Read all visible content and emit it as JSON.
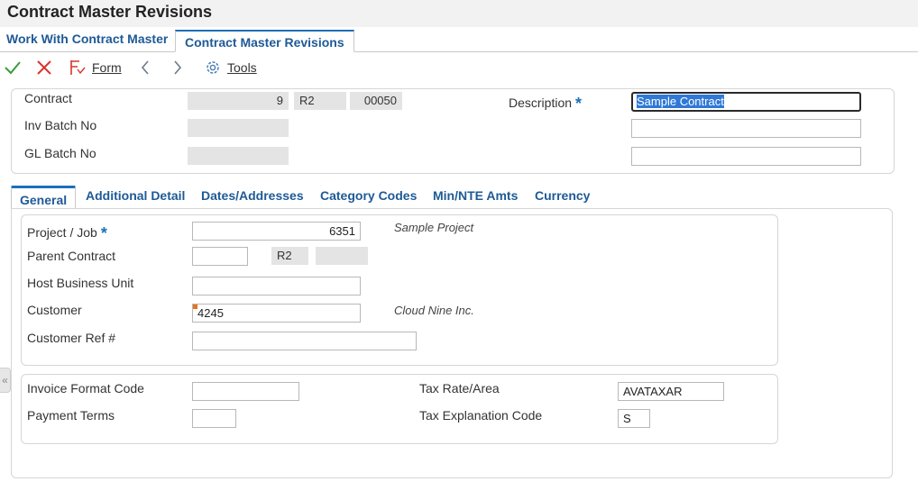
{
  "window": {
    "title": "Contract Master Revisions"
  },
  "breadcrumbs": [
    {
      "label": "Work With Contract Master"
    },
    {
      "label": "Contract Master Revisions"
    }
  ],
  "toolbar": {
    "ok_icon": "checkmark-icon",
    "cancel_icon": "x-icon",
    "form_label": "Form",
    "prev_icon": "chevron-left-icon",
    "next_icon": "chevron-right-icon",
    "tools_label": "Tools"
  },
  "header": {
    "contract_label": "Contract",
    "contract_number": "9",
    "contract_type": "R2",
    "contract_company": "00050",
    "description_label": "Description",
    "description_value": "Sample Contract",
    "inv_batch_label": "Inv Batch No",
    "inv_batch_value": "",
    "gl_batch_label": "GL Batch No",
    "gl_batch_value": "",
    "description_line2": "",
    "description_line3": ""
  },
  "tabs": [
    {
      "label": "General"
    },
    {
      "label": "Additional Detail"
    },
    {
      "label": "Dates/Addresses"
    },
    {
      "label": "Category Codes"
    },
    {
      "label": "Min/NTE Amts"
    },
    {
      "label": "Currency"
    }
  ],
  "general": {
    "project_label": "Project / Job",
    "project_value": "6351",
    "project_desc": "Sample Project",
    "parent_label": "Parent Contract",
    "parent_value": "",
    "parent_type": "R2",
    "parent_company": "",
    "host_bu_label": "Host Business Unit",
    "host_bu_value": "",
    "customer_label": "Customer",
    "customer_value": "4245",
    "customer_desc": "Cloud Nine Inc.",
    "customer_ref_label": "Customer Ref #",
    "customer_ref_value": "",
    "invoice_format_label": "Invoice Format Code",
    "invoice_format_value": "",
    "payment_terms_label": "Payment Terms",
    "payment_terms_value": "",
    "tax_rate_label": "Tax Rate/Area",
    "tax_rate_value": "AVATAXAR",
    "tax_expl_label": "Tax Explanation Code",
    "tax_expl_value": "S"
  },
  "colors": {
    "accent": "#1e6fba",
    "link": "#1e5a96",
    "ok": "#3a9b3a",
    "cancel": "#d9342b",
    "selection": "#2f78d6"
  }
}
